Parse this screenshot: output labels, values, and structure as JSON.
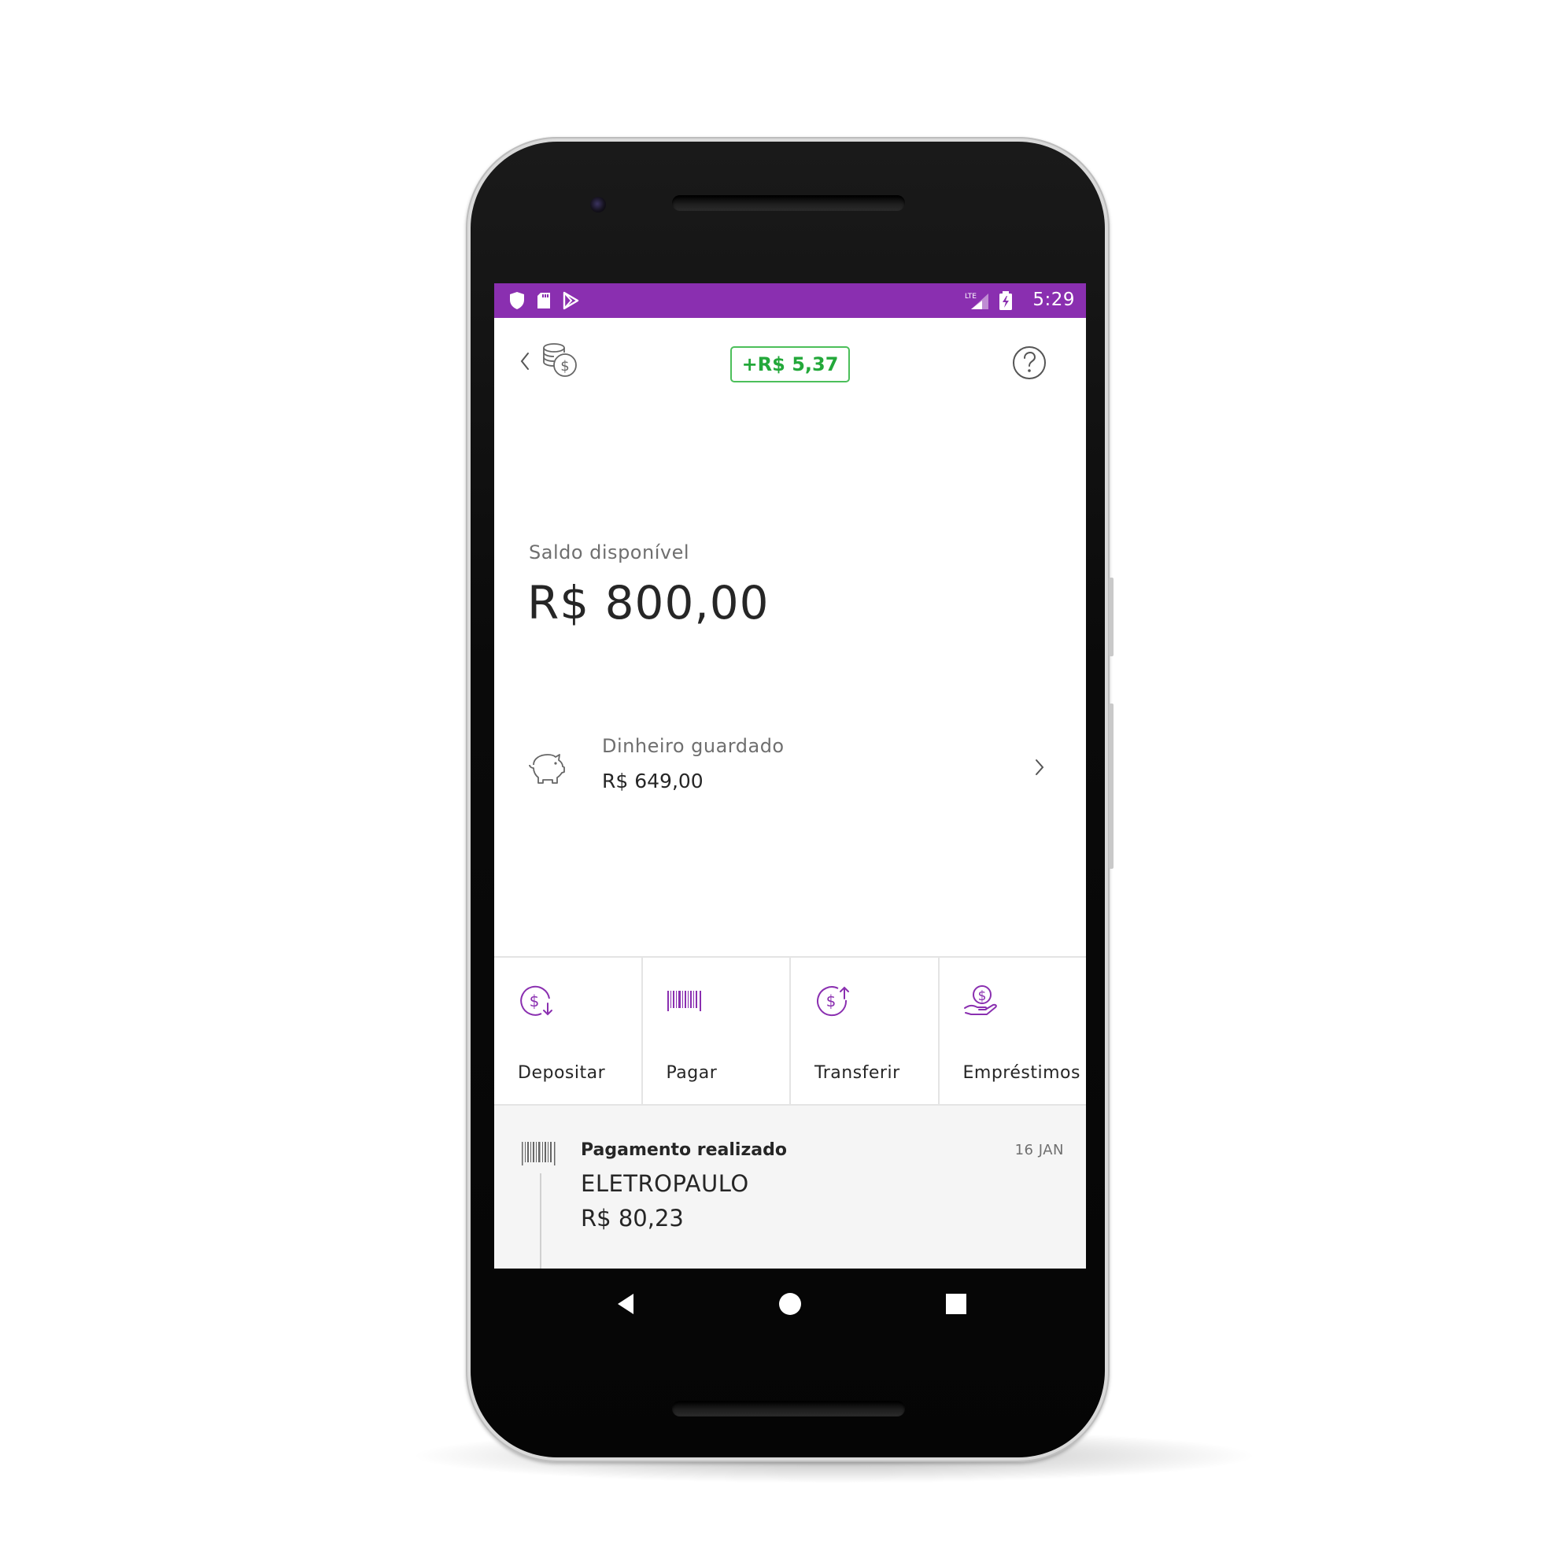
{
  "status_bar": {
    "time": "5:29",
    "network": "LTE",
    "left_icons": [
      "shield-icon",
      "sd-card-icon",
      "play-store-icon"
    ],
    "background": "#8a2fb0"
  },
  "header": {
    "back_icon": "chevron-left-icon",
    "coins_icon": "coins-dollar-icon",
    "earnings_badge": "+R$ 5,37",
    "help_icon": "help-circle-icon",
    "badge_color": "#23a83a"
  },
  "balance": {
    "label": "Saldo disponível",
    "value": "R$ 800,00"
  },
  "saved_money": {
    "label": "Dinheiro guardado",
    "value": "R$ 649,00",
    "icon": "piggy-bank-icon"
  },
  "actions": [
    {
      "label": "Depositar",
      "icon": "deposit-icon"
    },
    {
      "label": "Pagar",
      "icon": "barcode-icon"
    },
    {
      "label": "Transferir",
      "icon": "transfer-icon"
    },
    {
      "label": "Empréstimos",
      "icon": "loan-hand-icon"
    }
  ],
  "accent_color": "#8a2fb0",
  "feed": {
    "title": "Pagamento realizado",
    "date": "16 JAN",
    "merchant": "ELETROPAULO",
    "amount": "R$ 80,23",
    "icon": "barcode-icon"
  },
  "nav_bar": [
    "back-triangle-icon",
    "home-circle-icon",
    "recents-square-icon"
  ]
}
